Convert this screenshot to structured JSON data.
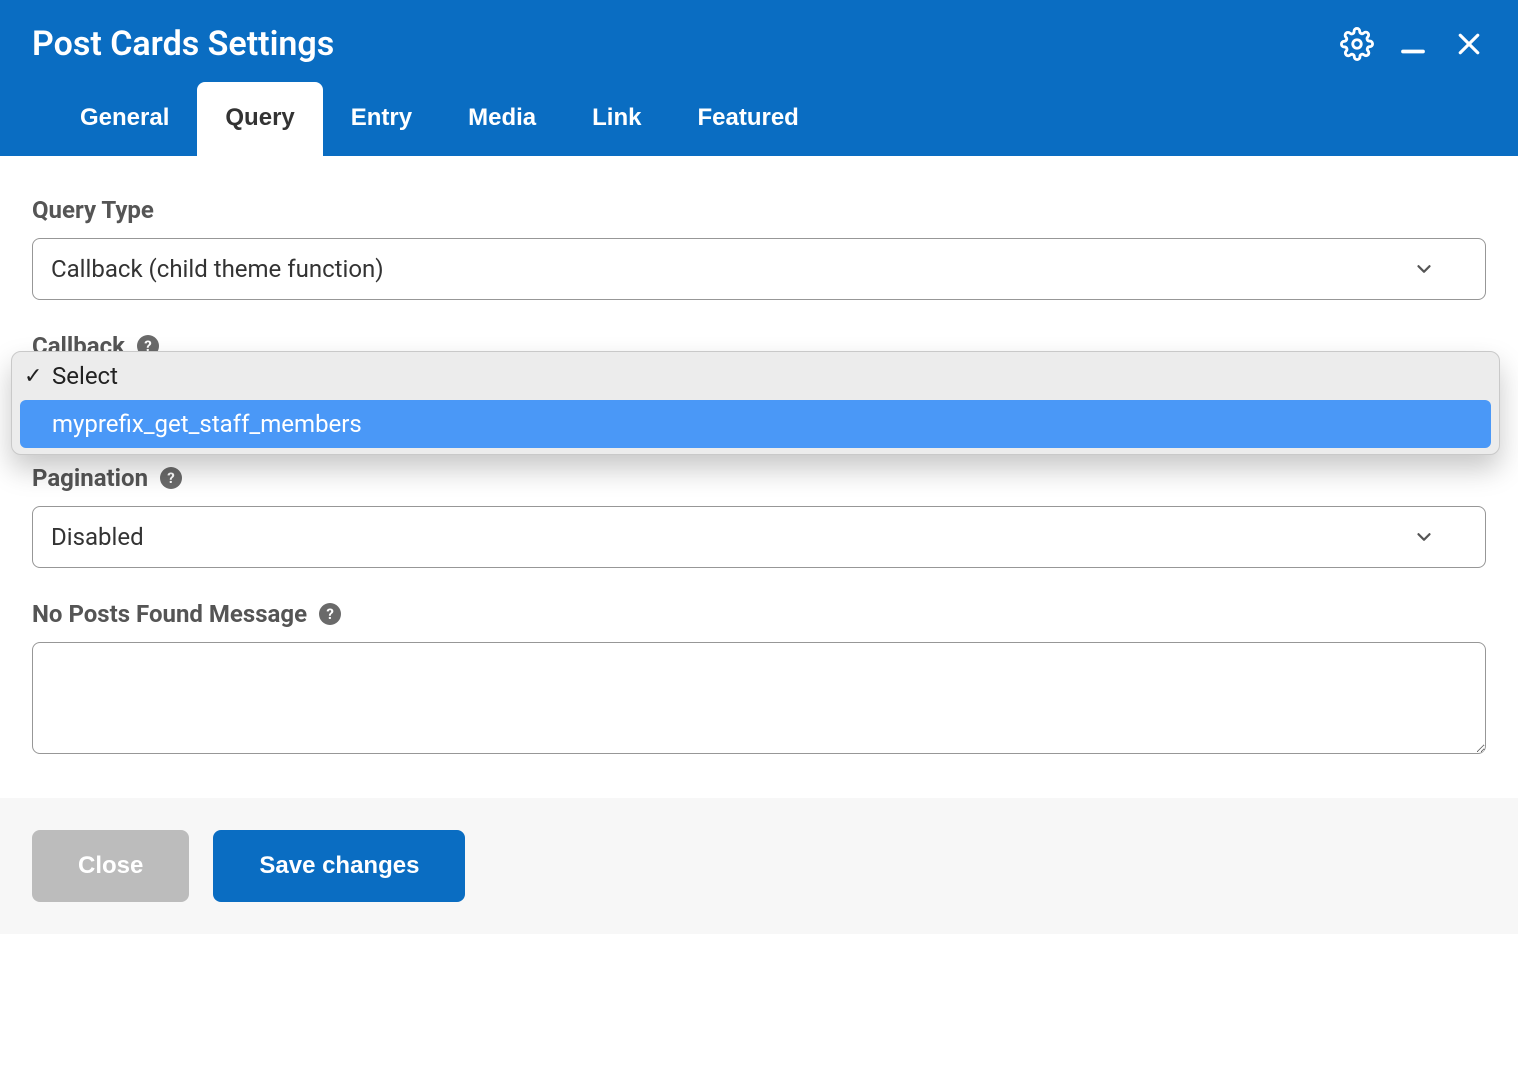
{
  "header": {
    "title": "Post Cards Settings"
  },
  "tabs": {
    "general": "General",
    "query": "Query",
    "entry": "Entry",
    "media": "Media",
    "link": "Link",
    "featured": "Featured"
  },
  "fields": {
    "query_type": {
      "label": "Query Type",
      "value": "Callback (child theme function)"
    },
    "callback": {
      "label": "Callback",
      "value": "",
      "options": {
        "select": "Select",
        "opt1": "myprefix_get_staff_members"
      }
    },
    "pagination": {
      "label": "Pagination",
      "value": "Disabled"
    },
    "no_posts": {
      "label": "No Posts Found Message",
      "value": ""
    }
  },
  "help_glyph": "?",
  "footer": {
    "close": "Close",
    "save": "Save changes"
  }
}
